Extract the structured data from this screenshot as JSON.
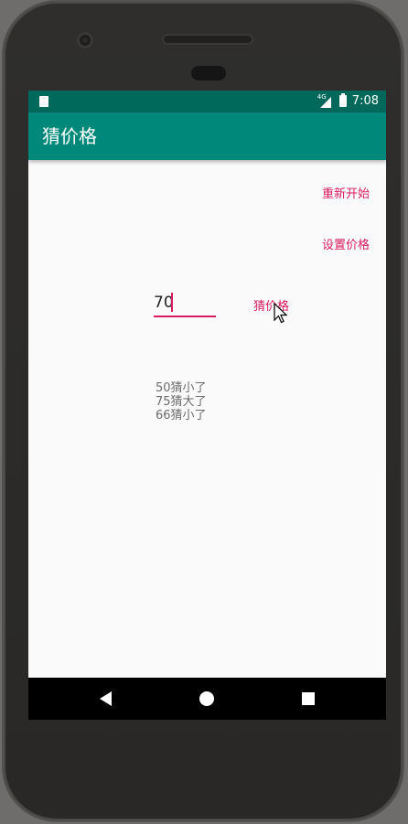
{
  "status_bar": {
    "network": "4G",
    "time": "7:08"
  },
  "app_bar": {
    "title": "猜价格"
  },
  "menu": {
    "restart_label": "重新开始",
    "set_price_label": "设置价格"
  },
  "guess": {
    "input_value": "70",
    "button_label": "猜价格"
  },
  "history": [
    "50猜小了",
    "75猜大了",
    "66猜小了"
  ],
  "colors": {
    "status_bar": "#00695c",
    "app_bar": "#00897b",
    "accent": "#d81b60"
  }
}
